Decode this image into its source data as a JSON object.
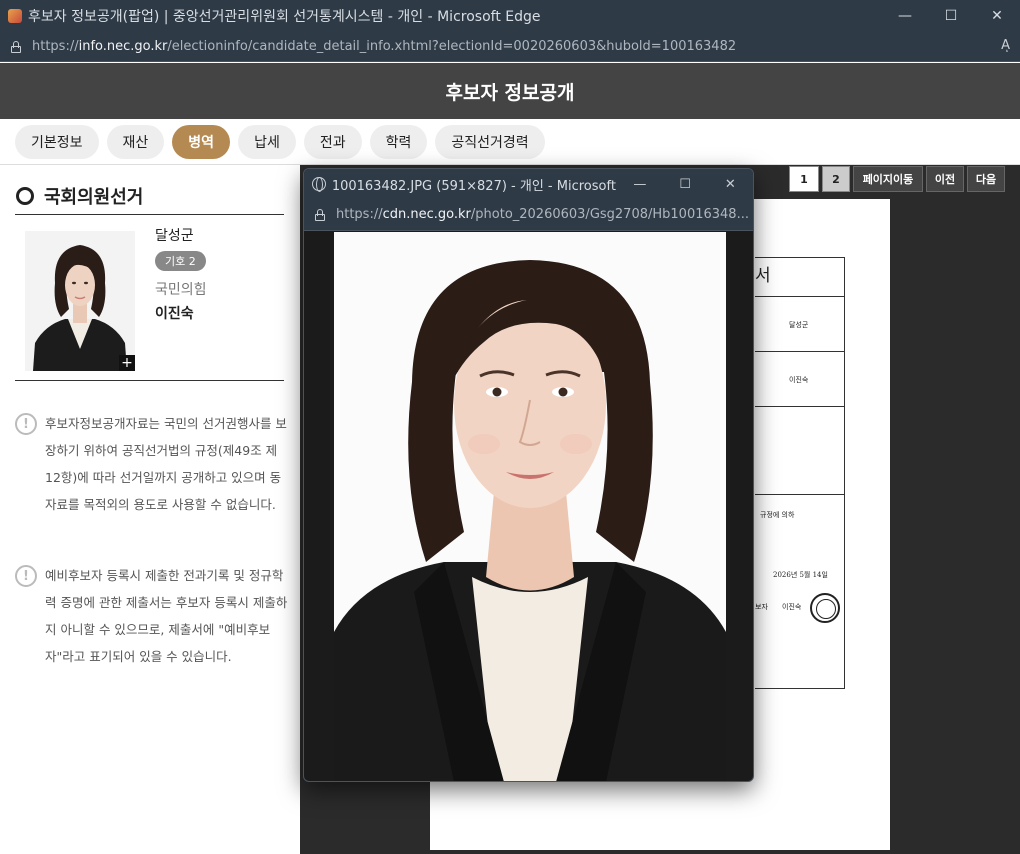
{
  "window": {
    "title": "후보자 정보공개(팝업) | 중앙선거관리위원회 선거통계시스템 - 개인 - Microsoft Edge",
    "minimize": "—",
    "maximize": "☐",
    "close": "✕",
    "url_scheme": "https://",
    "url_host": "info.nec.go.kr",
    "url_path": "/electioninfo/candidate_detail_info.xhtml?electionId=0020260603&hubold=100163482",
    "read_aloud": "Aͅ"
  },
  "header": {
    "title": "후보자 정보공개"
  },
  "tabs": [
    {
      "label": "기본정보",
      "active": false
    },
    {
      "label": "재산",
      "active": false
    },
    {
      "label": "병역",
      "active": true
    },
    {
      "label": "납세",
      "active": false
    },
    {
      "label": "전과",
      "active": false
    },
    {
      "label": "학력",
      "active": false
    },
    {
      "label": "공직선거경력",
      "active": false
    }
  ],
  "section": {
    "title": "국회의원선거"
  },
  "candidate": {
    "district": "달성군",
    "number_badge": "기호 2",
    "party": "국민의힘",
    "name": "이진숙",
    "enlarge_icon": "+"
  },
  "notes": [
    "후보자정보공개자료는 국민의 선거권행사를 보장하기 위하여 공직선거법의 규정(제49조 제12항)에 따라 선거일까지 공개하고 있으며 동 자료를 목적외의 용도로 사용할 수 없습니다.",
    "예비후보자 등록시 제출한 전과기록 및 정규학력 증명에 관한 제출서는 후보자 등록시 제출하지 아니할 수 있으므로, 제출서에 \"예비후보자\"라고 표기되어 있을 수 있습니다."
  ],
  "notes_icon": "!",
  "pager": {
    "page1": "1",
    "page2": "2",
    "goto": "페이지이동",
    "prev": "이전",
    "next": "다음"
  },
  "document": {
    "title_fragment": "서",
    "district": "달성군",
    "name": "이진숙",
    "regulation_text": "규정에 의하",
    "date": "2026년 5월 14일",
    "signer_label": "보자",
    "signer_name": "이진숙"
  },
  "popup": {
    "title": "100163482.JPG (591×827) - 개인 - Microsoft...",
    "url_scheme": "https://",
    "url_host": "cdn.nec.go.kr",
    "url_path": "/photo_20260603/Gsg2708/Hb10016348...",
    "minimize": "—",
    "maximize": "☐",
    "close": "✕"
  }
}
